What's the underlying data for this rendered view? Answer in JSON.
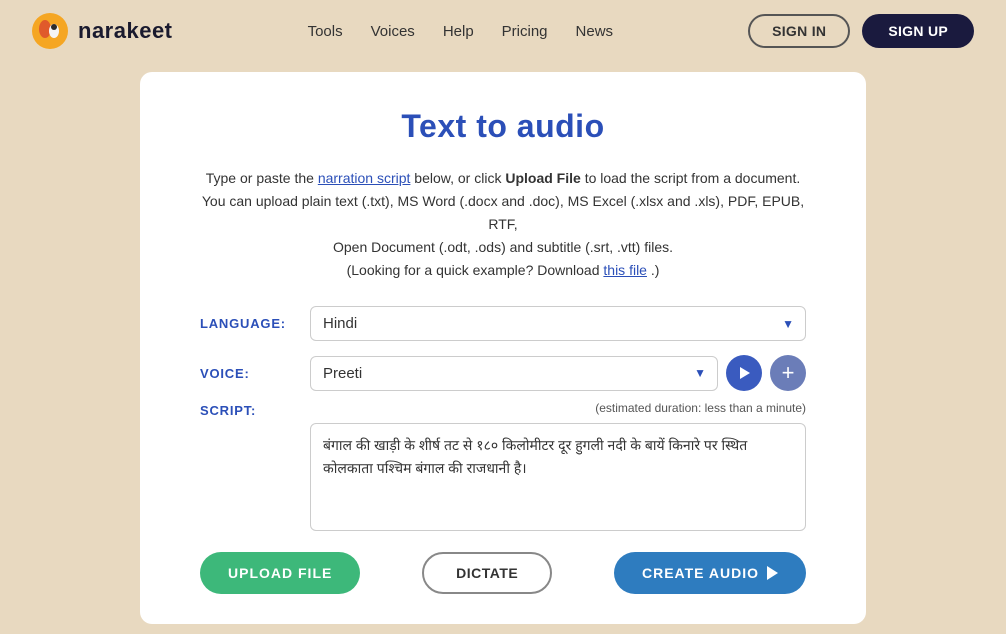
{
  "header": {
    "logo_text": "narakeet",
    "nav": {
      "tools": "Tools",
      "voices": "Voices",
      "help": "Help",
      "pricing": "Pricing",
      "news": "News"
    },
    "signin_label": "SIGN IN",
    "signup_label": "SIGN UP"
  },
  "main": {
    "card_title": "Text to audio",
    "description_line1": "Type or paste the",
    "narration_script_link": "narration script",
    "description_line2": "below, or click",
    "upload_bold": "Upload File",
    "description_line3": "to load the script from a document. You can upload plain text (.txt), MS Word (.docx and .doc), MS Excel (.xlsx and .xls), PDF, EPUB, RTF, Open Document (.odt, .ods) and subtitle (.srt, .vtt) files.",
    "looking_for_example": "(Looking for a quick example? Download",
    "this_file_link": "this file",
    "looking_for_example_end": ".)",
    "language_label": "LANGUAGE:",
    "language_value": "Hindi",
    "voice_label": "VOICE:",
    "voice_value": "Preeti",
    "script_label": "SCRIPT:",
    "estimated_duration": "(estimated duration: less than a minute)",
    "script_content": "बंगाल की खाड़ी के शीर्ष तट से १८० किलोमीटर दूर हुगली नदी के बायें किनारे पर स्थित कोलकाता पश्चिम बंगाल की राजधानी है।",
    "upload_file_label": "UPLOAD FILE",
    "dictate_label": "DICTATE",
    "create_audio_label": "CREATE AUDIO"
  }
}
